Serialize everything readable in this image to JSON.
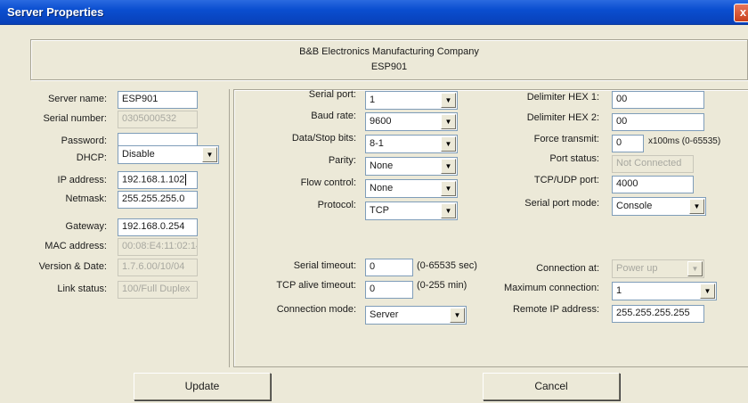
{
  "window": {
    "title": "Server Properties",
    "close_glyph": "x"
  },
  "header": {
    "company": "B&B Electronics Manufacturing Company",
    "model": "ESP901"
  },
  "left": {
    "server_name": {
      "label": "Server name:",
      "value": "ESP901"
    },
    "serial_number": {
      "label": "Serial number:",
      "value": "0305000532"
    },
    "password": {
      "label": "Password:",
      "value": ""
    },
    "dhcp": {
      "label": "DHCP:",
      "value": "Disable"
    },
    "ip_address": {
      "label": "IP address:",
      "value": "192.168.1.102"
    },
    "netmask": {
      "label": "Netmask:",
      "value": "255.255.255.0"
    },
    "gateway": {
      "label": "Gateway:",
      "value": "192.168.0.254"
    },
    "mac_address": {
      "label": "MAC address:",
      "value": "00:08:E4:11:02:14"
    },
    "version_date": {
      "label": "Version & Date:",
      "value": "1.7.6.00/10/04"
    },
    "link_status": {
      "label": "Link status:",
      "value": "100/Full Duplex"
    }
  },
  "mid": {
    "serial_port": {
      "label": "Serial port:",
      "value": "1"
    },
    "baud_rate": {
      "label": "Baud rate:",
      "value": "9600"
    },
    "data_stop_bits": {
      "label": "Data/Stop bits:",
      "value": "8-1"
    },
    "parity": {
      "label": "Parity:",
      "value": "None"
    },
    "flow_control": {
      "label": "Flow control:",
      "value": "None"
    },
    "protocol": {
      "label": "Protocol:",
      "value": "TCP"
    },
    "serial_timeout": {
      "label": "Serial timeout:",
      "value": "0",
      "suffix": "(0-65535 sec)"
    },
    "tcp_alive_timeout": {
      "label": "TCP alive timeout:",
      "value": "0",
      "suffix": "(0-255 min)"
    },
    "connection_mode": {
      "label": "Connection mode:",
      "value": "Server"
    }
  },
  "right": {
    "delimiter_hex_1": {
      "label": "Delimiter HEX 1:",
      "value": "00"
    },
    "delimiter_hex_2": {
      "label": "Delimiter HEX 2:",
      "value": "00"
    },
    "force_transmit": {
      "label": "Force transmit:",
      "value": "0",
      "suffix": "x100ms (0-65535)"
    },
    "port_status": {
      "label": "Port status:",
      "value": "Not Connected"
    },
    "tcp_udp_port": {
      "label": "TCP/UDP port:",
      "value": "4000"
    },
    "serial_port_mode": {
      "label": "Serial port mode:",
      "value": "Console"
    },
    "connection_at": {
      "label": "Connection at:",
      "value": "Power up"
    },
    "maximum_connection": {
      "label": "Maximum connection:",
      "value": "1"
    },
    "remote_ip": {
      "label": "Remote IP address:",
      "value": "255.255.255.255"
    }
  },
  "buttons": {
    "update": "Update",
    "cancel": "Cancel"
  },
  "colors": {
    "titlebar": "#0a4ed0",
    "dialog_bg": "#ece9d8",
    "field_border": "#7f9db9"
  }
}
